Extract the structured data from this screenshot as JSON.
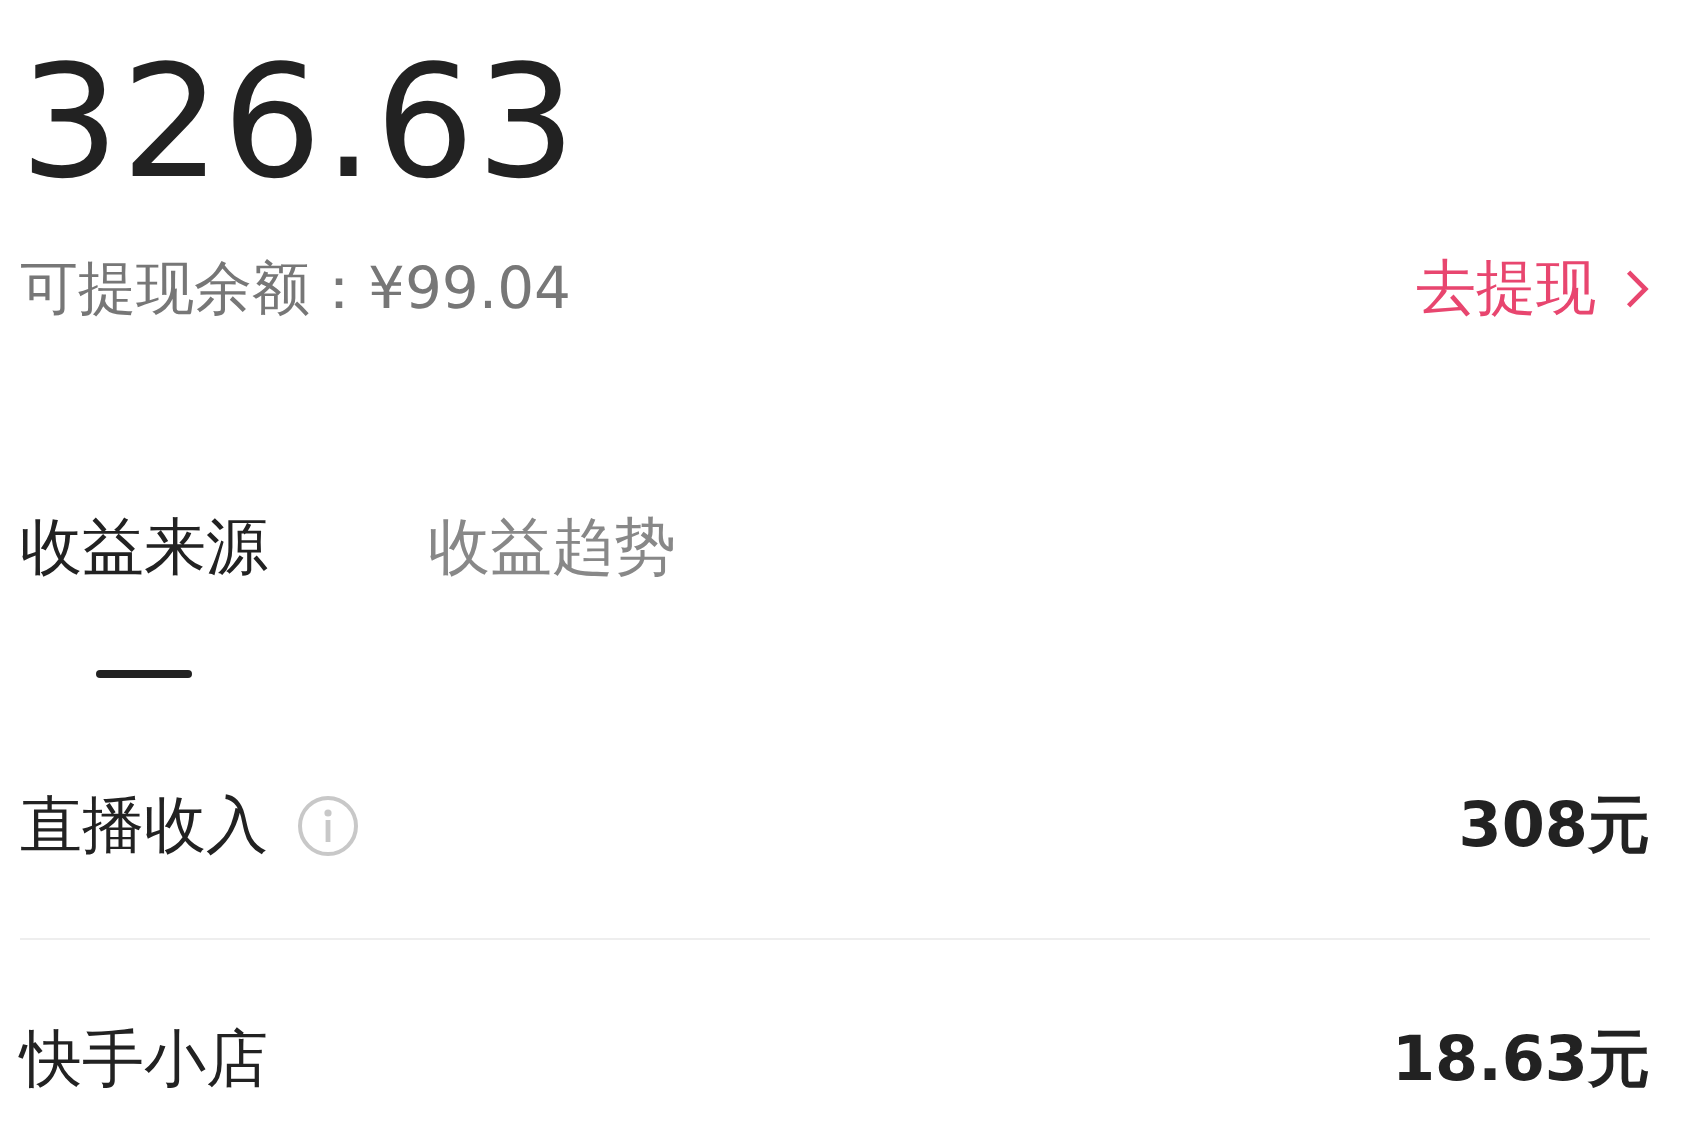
{
  "total": "326.63",
  "balance": {
    "label": "可提现余额：¥99.04",
    "action": "去提现"
  },
  "tabs": [
    {
      "label": "收益来源",
      "selected": true
    },
    {
      "label": "收益趋势",
      "selected": false
    }
  ],
  "rows": [
    {
      "name": "直播收入",
      "info": true,
      "amount": "308元"
    },
    {
      "name": "快手小店",
      "info": false,
      "amount": "18.63元"
    }
  ]
}
